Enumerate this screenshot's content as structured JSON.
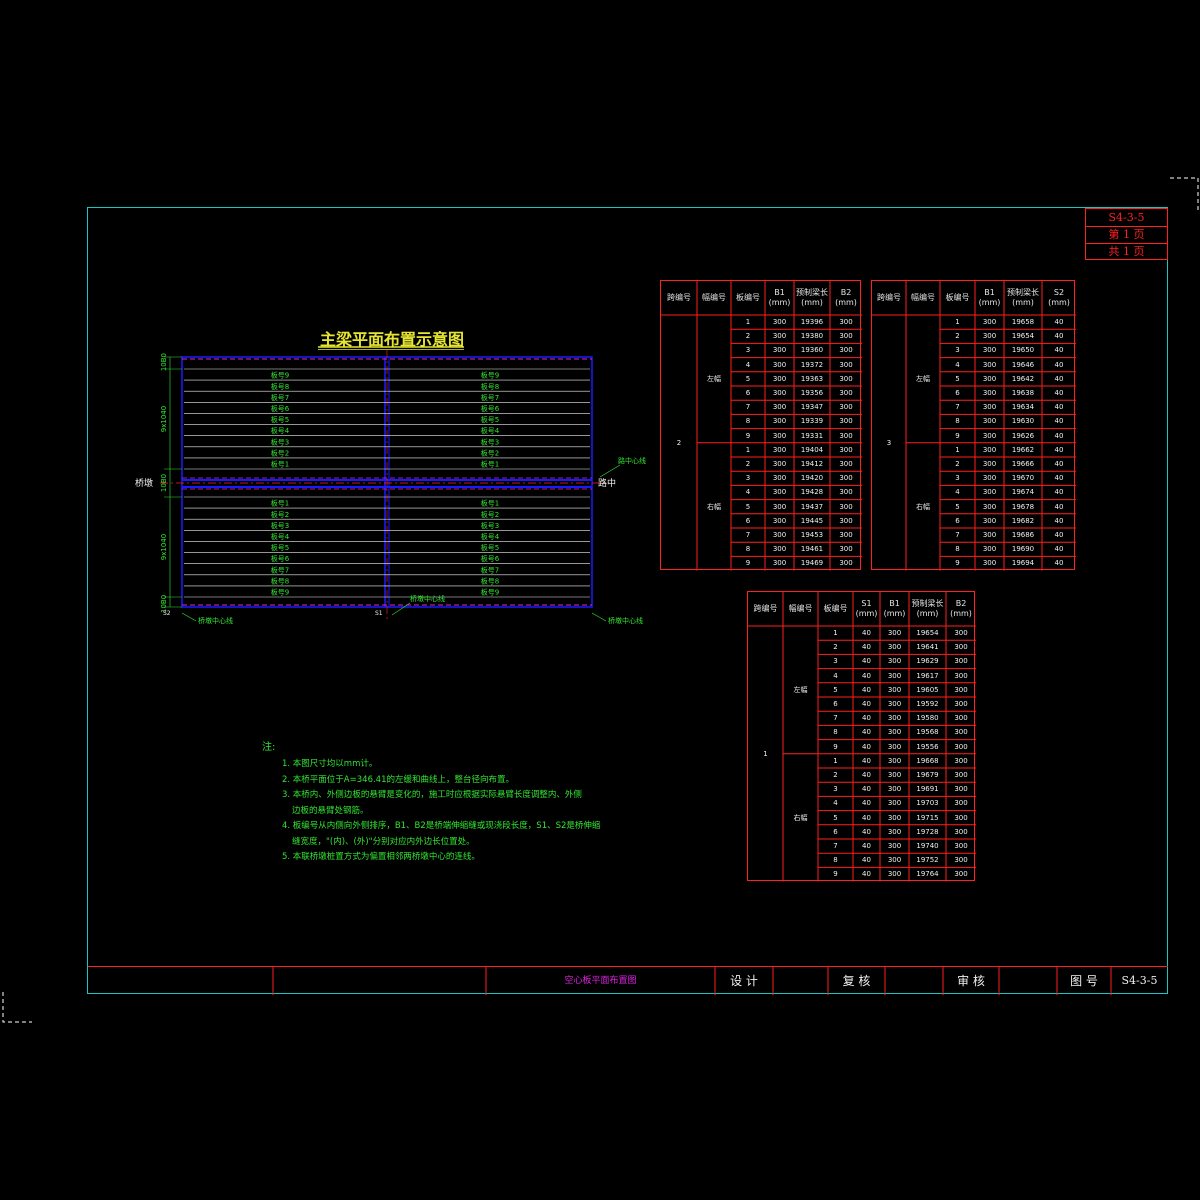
{
  "sheet_box": {
    "code": "S4-3-5",
    "page": "第 1 页",
    "total": "共 1 页"
  },
  "drawing": {
    "title": "主梁平面布置示意图",
    "plate_labels_top": [
      "板号9",
      "板号8",
      "板号7",
      "板号6",
      "板号5",
      "板号4",
      "板号3",
      "板号2",
      "板号1"
    ],
    "plate_labels_bottom": [
      "板号1",
      "板号2",
      "板号3",
      "板号4",
      "板号5",
      "板号6",
      "板号7",
      "板号8",
      "板号9"
    ],
    "dims_left": [
      "10B0",
      "9x1040",
      "10B0",
      "9x1040",
      "10B0"
    ],
    "label_left": "桥墩",
    "label_right": "路中心线",
    "label_right2": "路中",
    "label_bottom_mid": "桥墩中心线",
    "label_bottom_left": "桥墩中心线",
    "label_bottom_right": "桥墩中心线",
    "mark_s2": "S2",
    "mark_s1": "S1"
  },
  "notes": {
    "heading": "注:",
    "items": [
      "1. 本图尺寸均以mm计。",
      "2. 本桥平面位于A=346.41的左缓和曲线上，整台径向布置。",
      "3. 本桥内、外侧边板的悬臂是变化的，施工时应根据实际悬臂长度调整内、外侧",
      "边板的悬臂处钢筋。",
      "4. 板编号从内侧向外侧排序，B1、B2是桥端伸缩缝或现浇段长度，S1、S2是桥伸缩",
      "缝宽度，\"(内)、(外)\"分别对应内外边长位置处。",
      "5. 本联桥墩桩置方式为偏置相邻两桥墩中心的连线。"
    ]
  },
  "table_a": {
    "headers": [
      "跨编号",
      "幅编号",
      "板编号",
      "B1\n(mm)",
      "预制梁长\n(mm)",
      "B2\n(mm)"
    ],
    "span": "2",
    "groups": [
      {
        "side": "左幅",
        "rows": [
          [
            "1",
            "300",
            "19396",
            "300"
          ],
          [
            "2",
            "300",
            "19380",
            "300"
          ],
          [
            "3",
            "300",
            "19360",
            "300"
          ],
          [
            "4",
            "300",
            "19372",
            "300"
          ],
          [
            "5",
            "300",
            "19363",
            "300"
          ],
          [
            "6",
            "300",
            "19356",
            "300"
          ],
          [
            "7",
            "300",
            "19347",
            "300"
          ],
          [
            "8",
            "300",
            "19339",
            "300"
          ],
          [
            "9",
            "300",
            "19331",
            "300"
          ]
        ]
      },
      {
        "side": "右幅",
        "rows": [
          [
            "1",
            "300",
            "19404",
            "300"
          ],
          [
            "2",
            "300",
            "19412",
            "300"
          ],
          [
            "3",
            "300",
            "19420",
            "300"
          ],
          [
            "4",
            "300",
            "19428",
            "300"
          ],
          [
            "5",
            "300",
            "19437",
            "300"
          ],
          [
            "6",
            "300",
            "19445",
            "300"
          ],
          [
            "7",
            "300",
            "19453",
            "300"
          ],
          [
            "8",
            "300",
            "19461",
            "300"
          ],
          [
            "9",
            "300",
            "19469",
            "300"
          ]
        ]
      }
    ]
  },
  "table_b": {
    "headers": [
      "跨编号",
      "幅编号",
      "板编号",
      "B1\n(mm)",
      "预制梁长\n(mm)",
      "S2\n(mm)"
    ],
    "span": "3",
    "groups": [
      {
        "side": "左幅",
        "rows": [
          [
            "1",
            "300",
            "19658",
            "40"
          ],
          [
            "2",
            "300",
            "19654",
            "40"
          ],
          [
            "3",
            "300",
            "19650",
            "40"
          ],
          [
            "4",
            "300",
            "19646",
            "40"
          ],
          [
            "5",
            "300",
            "19642",
            "40"
          ],
          [
            "6",
            "300",
            "19638",
            "40"
          ],
          [
            "7",
            "300",
            "19634",
            "40"
          ],
          [
            "8",
            "300",
            "19630",
            "40"
          ],
          [
            "9",
            "300",
            "19626",
            "40"
          ]
        ]
      },
      {
        "side": "右幅",
        "rows": [
          [
            "1",
            "300",
            "19662",
            "40"
          ],
          [
            "2",
            "300",
            "19666",
            "40"
          ],
          [
            "3",
            "300",
            "19670",
            "40"
          ],
          [
            "4",
            "300",
            "19674",
            "40"
          ],
          [
            "5",
            "300",
            "19678",
            "40"
          ],
          [
            "6",
            "300",
            "19682",
            "40"
          ],
          [
            "7",
            "300",
            "19686",
            "40"
          ],
          [
            "8",
            "300",
            "19690",
            "40"
          ],
          [
            "9",
            "300",
            "19694",
            "40"
          ]
        ]
      }
    ]
  },
  "table_c": {
    "headers": [
      "跨编号",
      "幅编号",
      "板编号",
      "S1\n(mm)",
      "B1\n(mm)",
      "预制梁长\n(mm)",
      "B2\n(mm)"
    ],
    "span": "1",
    "groups": [
      {
        "side": "左幅",
        "rows": [
          [
            "1",
            "40",
            "300",
            "19654",
            "300"
          ],
          [
            "2",
            "40",
            "300",
            "19641",
            "300"
          ],
          [
            "3",
            "40",
            "300",
            "19629",
            "300"
          ],
          [
            "4",
            "40",
            "300",
            "19617",
            "300"
          ],
          [
            "5",
            "40",
            "300",
            "19605",
            "300"
          ],
          [
            "6",
            "40",
            "300",
            "19592",
            "300"
          ],
          [
            "7",
            "40",
            "300",
            "19580",
            "300"
          ],
          [
            "8",
            "40",
            "300",
            "19568",
            "300"
          ],
          [
            "9",
            "40",
            "300",
            "19556",
            "300"
          ]
        ]
      },
      {
        "side": "右幅",
        "rows": [
          [
            "1",
            "40",
            "300",
            "19668",
            "300"
          ],
          [
            "2",
            "40",
            "300",
            "19679",
            "300"
          ],
          [
            "3",
            "40",
            "300",
            "19691",
            "300"
          ],
          [
            "4",
            "40",
            "300",
            "19703",
            "300"
          ],
          [
            "5",
            "40",
            "300",
            "19715",
            "300"
          ],
          [
            "6",
            "40",
            "300",
            "19728",
            "300"
          ],
          [
            "7",
            "40",
            "300",
            "19740",
            "300"
          ],
          [
            "8",
            "40",
            "300",
            "19752",
            "300"
          ],
          [
            "9",
            "40",
            "300",
            "19764",
            "300"
          ]
        ]
      }
    ]
  },
  "title_block": {
    "drawing_name": "空心板平面布置图",
    "design": "设 计",
    "check": "复 核",
    "review": "审 核",
    "drawing_no_label": "图 号",
    "drawing_no": "S4-3-5"
  },
  "colors": {
    "frame": "#19c5c5",
    "table": "#ff2020",
    "text_green": "#32e632",
    "text_yellow": "#e6e632",
    "beam_line": "#1a1aff"
  }
}
